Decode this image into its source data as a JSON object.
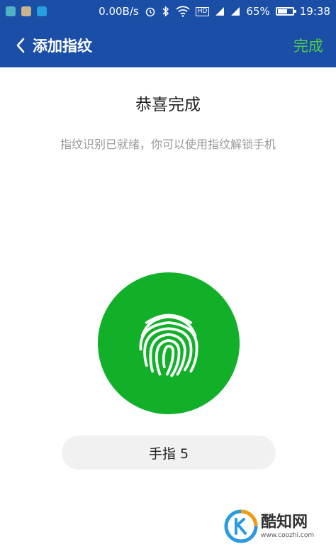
{
  "status_bar": {
    "speed": "0.00B/s",
    "hd": "HD",
    "battery": "65%",
    "battery_level": 0.65,
    "time": "19:38"
  },
  "toolbar": {
    "title": "添加指纹",
    "done_label": "完成"
  },
  "content": {
    "heading": "恭喜完成",
    "subtitle": "指纹识别已就绪，你可以使用指纹解锁手机",
    "finger_label": "手指 5"
  },
  "watermark": {
    "name": "酷知网",
    "url": "www.coozhi.com"
  },
  "colors": {
    "accent_blue": "#1b4ea6",
    "done_green": "#4ccd4a",
    "fingerprint_green": "#12b029"
  }
}
